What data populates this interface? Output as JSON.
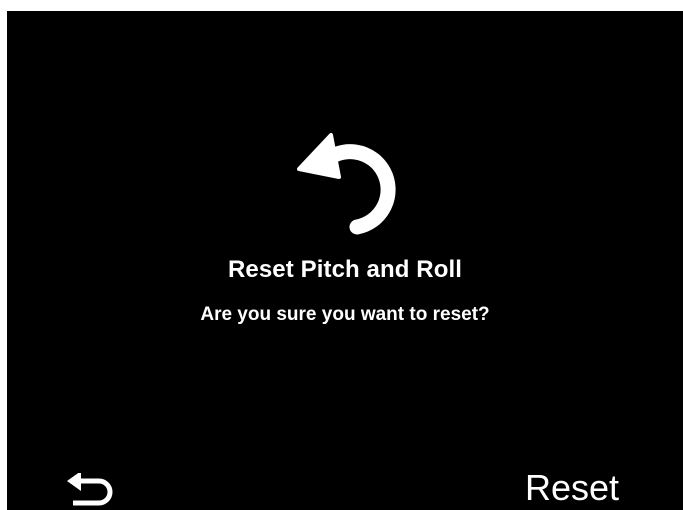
{
  "dialog": {
    "icon": "undo-arrow-icon",
    "title": "Reset Pitch and Roll",
    "message": "Are you sure you want to reset?"
  },
  "footer": {
    "back_icon": "return-arrow-icon",
    "reset_label": "Reset"
  },
  "colors": {
    "background": "#000000",
    "foreground": "#ffffff"
  }
}
